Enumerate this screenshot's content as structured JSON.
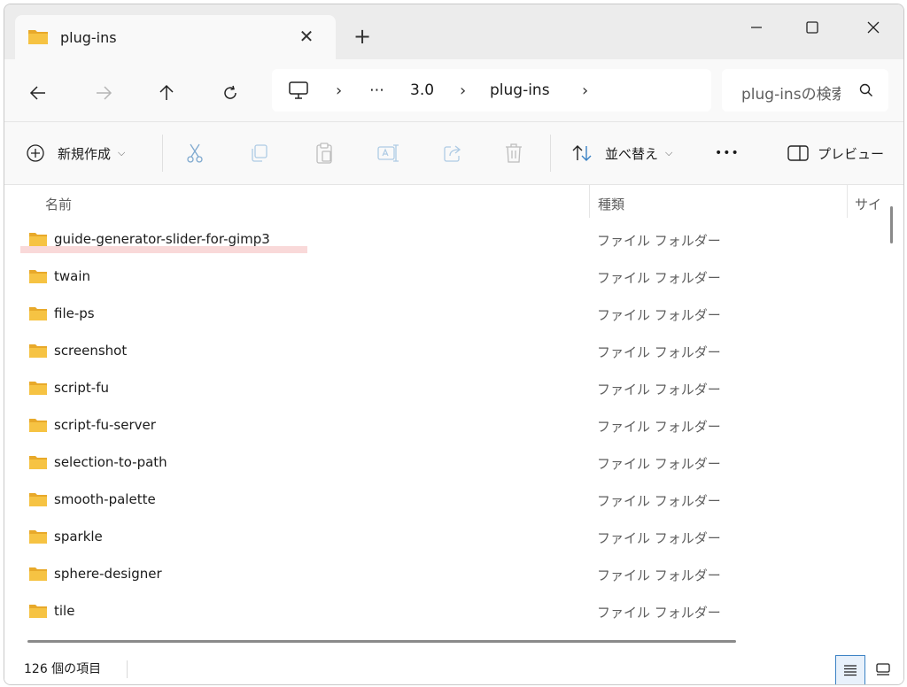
{
  "tab": {
    "title": "plug-ins"
  },
  "address": {
    "segments": [
      "3.0",
      "plug-ins"
    ],
    "ellipsis": "⋯"
  },
  "search": {
    "placeholder": "plug-insの検索"
  },
  "toolbar": {
    "new_label": "新規作成",
    "sort_label": "並べ替え",
    "preview_label": "プレビュー",
    "more_label": "•••"
  },
  "columns": {
    "name": "名前",
    "type": "種類",
    "size": "サイ"
  },
  "files": [
    {
      "name": "guide-generator-slider-for-gimp3",
      "type": "ファイル フォルダー"
    },
    {
      "name": "twain",
      "type": "ファイル フォルダー"
    },
    {
      "name": "file-ps",
      "type": "ファイル フォルダー"
    },
    {
      "name": "screenshot",
      "type": "ファイル フォルダー"
    },
    {
      "name": "script-fu",
      "type": "ファイル フォルダー"
    },
    {
      "name": "script-fu-server",
      "type": "ファイル フォルダー"
    },
    {
      "name": "selection-to-path",
      "type": "ファイル フォルダー"
    },
    {
      "name": "smooth-palette",
      "type": "ファイル フォルダー"
    },
    {
      "name": "sparkle",
      "type": "ファイル フォルダー"
    },
    {
      "name": "sphere-designer",
      "type": "ファイル フォルダー"
    },
    {
      "name": "tile",
      "type": "ファイル フォルダー"
    }
  ],
  "status": {
    "item_count": "126 個の項目"
  },
  "colors": {
    "folder": "#f6c343",
    "accent": "#3b82c4"
  }
}
